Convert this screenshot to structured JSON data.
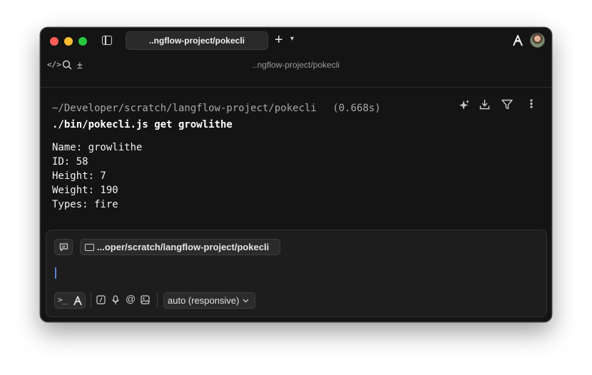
{
  "tab": {
    "title": "..ngflow-project/pokecli",
    "new_tab": "+",
    "dropdown": "⌄"
  },
  "header": {
    "path_title": "..ngflow-project/pokecli"
  },
  "toolbar": {
    "code_icon": "</>",
    "search_icon": "⌕",
    "plusminus_icon": "±"
  },
  "block": {
    "cwd": "~/Developer/scratch/langflow-project/pokecli",
    "duration": "(0.668s)",
    "command": "./bin/pokecli.js get growlithe",
    "output": [
      "Name: growlithe",
      "ID: 58",
      "Height: 7",
      "Weight: 190",
      "Types: fire"
    ],
    "actions": {
      "ai": "✦",
      "download": "⤓",
      "filter": "⏷",
      "more": "⋮"
    }
  },
  "input": {
    "directory": "...oper/scratch/langflow-project/pokecli",
    "model": "auto (responsive)",
    "terminal_mode": ">_",
    "icons": {
      "slash": "⁄",
      "mic": "🎙",
      "at": "@",
      "image": "🖼",
      "chevron": "⌄"
    }
  },
  "colors": {
    "window_bg": "#141414",
    "panel_bg": "#1d1d1d",
    "caret": "#5a82c8"
  }
}
